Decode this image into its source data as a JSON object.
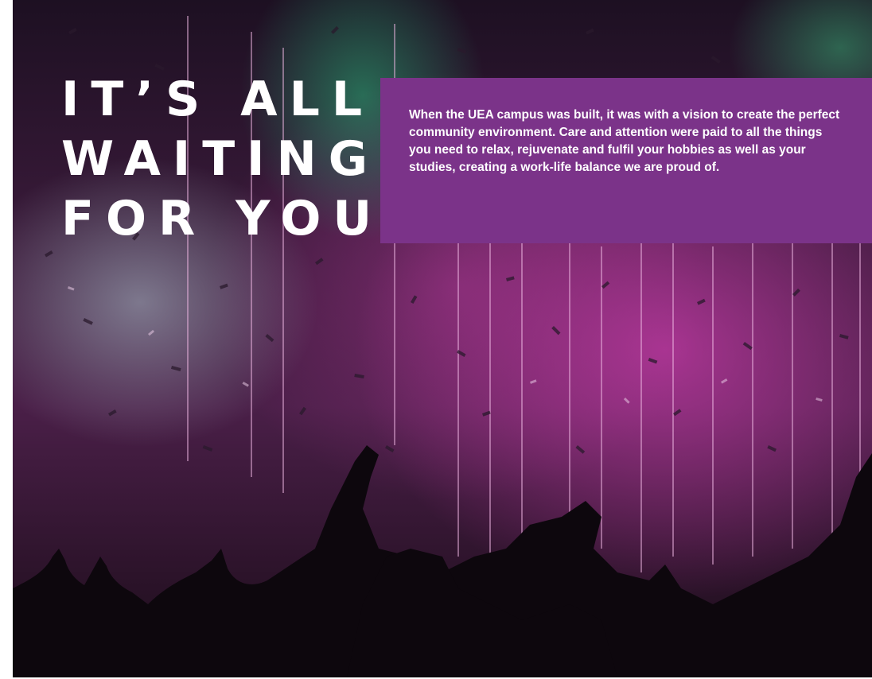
{
  "headline": {
    "line1": "IT’S ALL",
    "line2": "WAITING",
    "line3": "FOR YOU"
  },
  "intro": {
    "text": "When the UEA campus was built, it was with a vision to create the perfect community environment. Care and attention were paid to all the things you need to relax, rejuvenate and fulfil your hobbies as well as your studies, creating a work-life balance we are proud of."
  },
  "colors": {
    "text_box_purple": "#7b3389",
    "headline_white": "#ffffff"
  }
}
